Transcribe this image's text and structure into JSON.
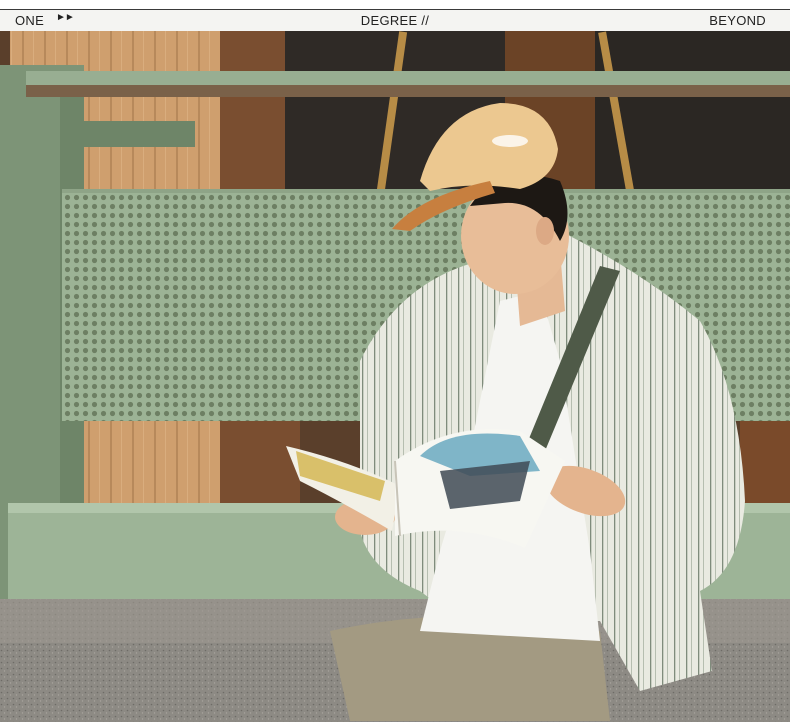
{
  "header": {
    "left_label": "ONE",
    "arrows": "►►",
    "center_label": "DEGREE //",
    "right_label": "BEYOND"
  },
  "photo": {
    "description_icon": "photo-person-reading-magazine"
  },
  "colors": {
    "header_bg": "#f4f4f2",
    "header_text": "#222222",
    "wall_green": "#8fa58a",
    "wood": "#c99a6a",
    "cap": "#e9c58e",
    "shirt": "#e7e8de"
  }
}
